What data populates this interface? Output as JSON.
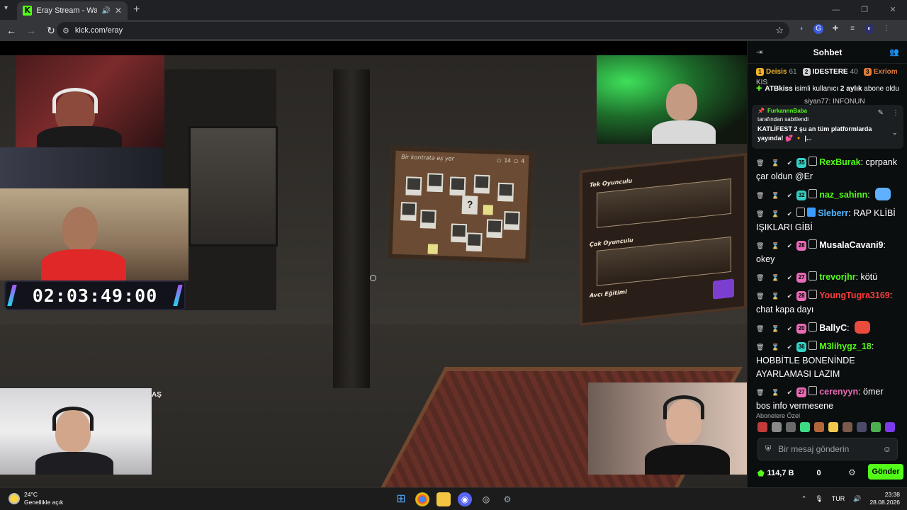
{
  "browser": {
    "tab_title": "Eray Stream - Watch Live on Kick",
    "url": "kick.com/eray"
  },
  "stream": {
    "timer": "02:03:49:00",
    "overlay_cut_text": "AŞ",
    "board_title": "Bir kontrata eş yer",
    "board_score": "▢ 14   ▢ 4",
    "menu_items": [
      "Tek Oyunculu",
      "Çok Oyunculu",
      "Avcı Eğitimi"
    ]
  },
  "chat": {
    "title": "Sohbet",
    "leaderboard": [
      {
        "rank": "1",
        "name": "Deisis",
        "count": "61",
        "color": "#f0b429",
        "name_color": "#f0b429"
      },
      {
        "rank": "2",
        "name": "IDESTERE",
        "count": "40",
        "color": "#d0d0d0",
        "name_color": "#ffffff"
      },
      {
        "rank": "3",
        "name": "Exriom",
        "count": "",
        "color": "#e07b39",
        "name_color": "#e07b39"
      }
    ],
    "behind_top": "KIS",
    "behind_mid": "siyan77: INFONUN",
    "sub_notice": {
      "user": "ATBkiss",
      "mid": " isimli kullanıcı ",
      "months": "2 aylık",
      "end": " abone oldu"
    },
    "pinned": {
      "user": "FurkannnBaba",
      "by": "tarafından sabitlendi",
      "text": "KATLİFEST 2 şu an tüm platformlarda yayında! 💕 🔸 |..."
    },
    "messages": [
      {
        "mods": "🗑 ⌛ ✔",
        "level": "35",
        "level_color": "#35d0c4",
        "user": "RexBurak",
        "user_color": "#53fc18",
        "text": "cprpank çar oldun @Er",
        "emote": ""
      },
      {
        "mods": "🗑 ⌛ ✔",
        "level": "32",
        "level_color": "#35d0c4",
        "user": "naz_sahinn",
        "user_color": "#53fc18",
        "text": "",
        "emote": "#5fb0ff"
      },
      {
        "mods": "🗑 ⌛ ✔",
        "level": "",
        "level_color": "",
        "user": "Sleberr",
        "user_color": "#53b7ff",
        "text": "RAP KLİBİ IŞIKLARI GİBİ",
        "emote": ""
      },
      {
        "mods": "🗑 ⌛ ✔",
        "level": "28",
        "level_color": "#e96ab6",
        "user": "MusalaCavani9",
        "user_color": "#ffffff",
        "text": "okey",
        "emote": ""
      },
      {
        "mods": "🗑 ⌛ ✔",
        "level": "27",
        "level_color": "#e96ab6",
        "user": "trevorjhr",
        "user_color": "#53fc18",
        "text": "kötü",
        "emote": ""
      },
      {
        "mods": "🗑 ⌛ ✔",
        "level": "28",
        "level_color": "#e96ab6",
        "user": "YoungTugra3169",
        "user_color": "#ff3b3b",
        "text": "chat kapa dayı",
        "emote": ""
      },
      {
        "mods": "🗑 ⌛ ✔",
        "level": "20",
        "level_color": "#e96ab6",
        "user": "BallyC",
        "user_color": "#ffffff",
        "text": "",
        "emote": "#e94b3c"
      },
      {
        "mods": "🗑 ⌛ ✔",
        "level": "36",
        "level_color": "#35d0c4",
        "user": "M3lihygz_18",
        "user_color": "#53fc18",
        "text": "HOBBİTLE BONENİNDE AYARLAMASI LAZIM",
        "emote": ""
      },
      {
        "mods": "🗑 ⌛ ✔",
        "level": "27",
        "level_color": "#e96ab6",
        "user": "cerenyyn",
        "user_color": "#e96ab6",
        "text": "ömer bos info vermesene",
        "emote": ""
      }
    ],
    "emote_bar_label": "Abonelere Özel",
    "input_placeholder": "Bir mesaj gönderin",
    "points": "114,7 B",
    "zero": "0",
    "send_label": "Gönder"
  },
  "taskbar": {
    "temp": "24°C",
    "weather": "Genellikle açık",
    "lang": "TUR",
    "time": "23:38",
    "date": "28.08.2026"
  }
}
